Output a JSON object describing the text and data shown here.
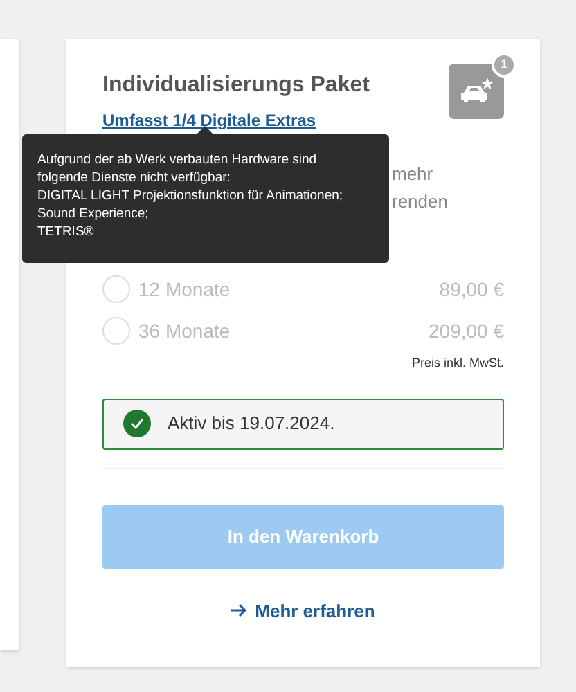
{
  "package": {
    "title": "Individualisierungs Paket",
    "link": "Umfasst 1/4 Digitale Extras",
    "badge": "1",
    "description_fragments": [
      "mehr",
      "renden"
    ]
  },
  "tooltip": {
    "lines": [
      "Aufgrund der ab Werk verbauten Hardware sind folgende Dienste nicht verfügbar:",
      "DIGITAL LIGHT Projektionsfunktion für Animationen;",
      "Sound Experience;",
      "TETRIS®"
    ]
  },
  "options": [
    {
      "label": "12 Monate",
      "price": "89,00 €",
      "selected": false,
      "disabled": true
    },
    {
      "label": "36 Monate",
      "price": "209,00 €",
      "selected": false,
      "disabled": true
    }
  ],
  "price_note": "Preis inkl. MwSt.",
  "status": {
    "text": "Aktiv bis 19.07.2024."
  },
  "cart_button": {
    "label": "In den Warenkorb",
    "disabled": true
  },
  "more_link": {
    "label": "Mehr erfahren"
  }
}
